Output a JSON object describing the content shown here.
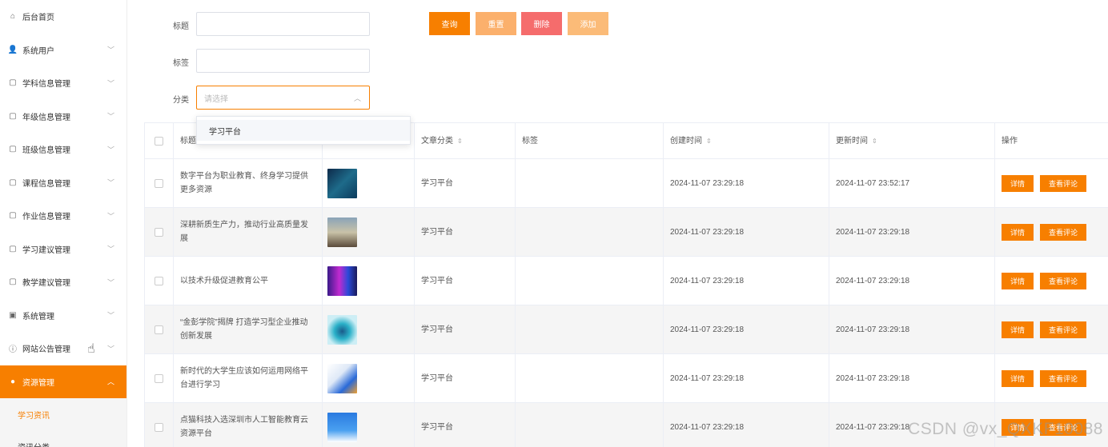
{
  "sidebar": {
    "items": [
      {
        "label": "后台首页",
        "icon": "home-icon",
        "glyph": "⌂",
        "chevron": false
      },
      {
        "label": "系统用户",
        "icon": "user-icon",
        "glyph": "👤",
        "chevron": true
      },
      {
        "label": "学科信息管理",
        "icon": "doc-icon",
        "glyph": "▢",
        "chevron": true
      },
      {
        "label": "年级信息管理",
        "icon": "doc-icon",
        "glyph": "▢",
        "chevron": true
      },
      {
        "label": "班级信息管理",
        "icon": "doc-icon",
        "glyph": "▢",
        "chevron": true
      },
      {
        "label": "课程信息管理",
        "icon": "doc-icon",
        "glyph": "▢",
        "chevron": true
      },
      {
        "label": "作业信息管理",
        "icon": "doc-icon",
        "glyph": "▢",
        "chevron": true
      },
      {
        "label": "学习建议管理",
        "icon": "doc-icon",
        "glyph": "▢",
        "chevron": true
      },
      {
        "label": "教学建议管理",
        "icon": "doc-icon",
        "glyph": "▢",
        "chevron": true
      },
      {
        "label": "系统管理",
        "icon": "picture-icon",
        "glyph": "▣",
        "chevron": true
      },
      {
        "label": "网站公告管理",
        "icon": "info-icon",
        "glyph": "ⓘ",
        "chevron": true
      },
      {
        "label": "资源管理",
        "icon": "bulb-icon",
        "glyph": "●",
        "chevron": true,
        "active": true
      }
    ],
    "sub_items": [
      {
        "label": "学习资讯",
        "active": true
      },
      {
        "label": "资讯分类",
        "active": false
      }
    ]
  },
  "search": {
    "title_label": "标题",
    "tag_label": "标签",
    "category_label": "分类",
    "category_placeholder": "请选择",
    "dropdown_options": [
      "学习平台"
    ]
  },
  "toolbar": {
    "query": "查询",
    "reset": "重置",
    "delete": "删除",
    "add": "添加"
  },
  "colors": {
    "accent": "#f77f00",
    "reset": "#fbb06c",
    "delete": "#f56c6c",
    "add": "#fbbb78"
  },
  "table": {
    "headers": {
      "title": "标题",
      "category": "文章分类",
      "tags": "标签",
      "created": "创建时间",
      "updated": "更新时间",
      "actions": "操作"
    },
    "detail_label": "详情",
    "comment_label": "查看评论",
    "rows": [
      {
        "title": "数字平台为职业教育、终身学习提供更多资源",
        "category": "学习平台",
        "tags": "",
        "created": "2024-11-07 23:29:18",
        "updated": "2024-11-07 23:52:17",
        "thumb": "thumb-digital"
      },
      {
        "title": "深耕新质生产力，推动行业高质量发展",
        "category": "学习平台",
        "tags": "",
        "created": "2024-11-07 23:29:18",
        "updated": "2024-11-07 23:29:18",
        "thumb": "thumb-calligraphy"
      },
      {
        "title": "以技术升级促进教育公平",
        "category": "学习平台",
        "tags": "",
        "created": "2024-11-07 23:29:18",
        "updated": "2024-11-07 23:29:18",
        "thumb": "thumb-tech"
      },
      {
        "title": "“金彭学院”揭牌 打造学习型企业推动创新发展",
        "category": "学习平台",
        "tags": "",
        "created": "2024-11-07 23:29:18",
        "updated": "2024-11-07 23:29:18",
        "thumb": "thumb-network"
      },
      {
        "title": "新时代的大学生应该如何运用网络平台进行学习",
        "category": "学习平台",
        "tags": "",
        "created": "2024-11-07 23:29:18",
        "updated": "2024-11-07 23:29:18",
        "thumb": "thumb-study"
      },
      {
        "title": "点猫科技入选深圳市人工智能教育云资源平台",
        "category": "学习平台",
        "tags": "",
        "created": "2024-11-07 23:29:18",
        "updated": "2024-11-07 23:29:18",
        "thumb": "thumb-ai"
      }
    ]
  },
  "watermark": "CSDN @vx_QXKF10088"
}
